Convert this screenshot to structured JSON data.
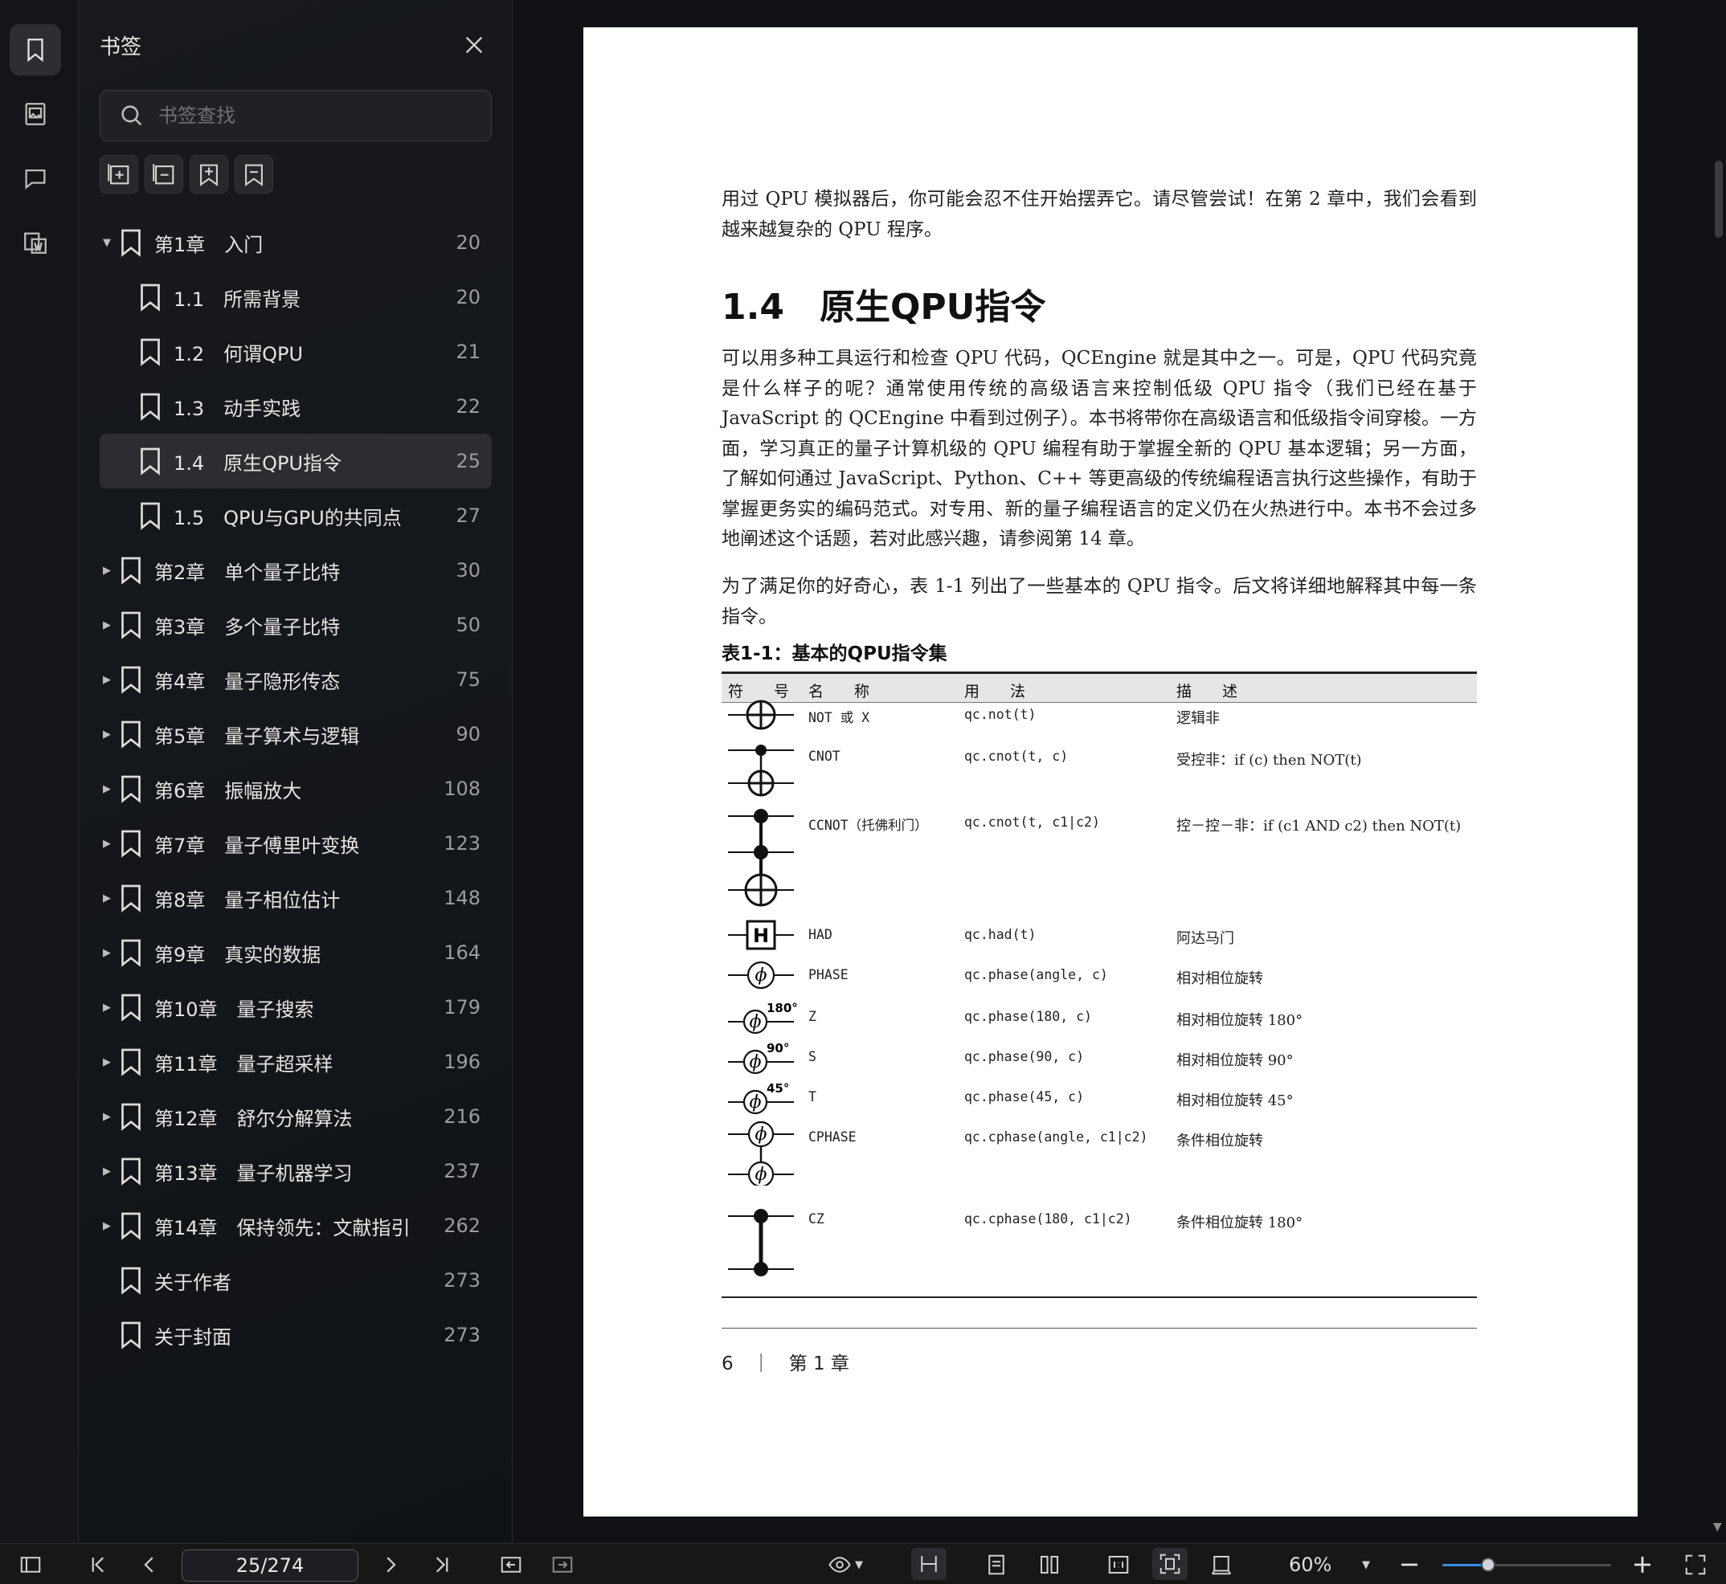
{
  "sidebar": {
    "title": "书签",
    "search_placeholder": "书签查找",
    "items": [
      {
        "label": "第1章　入门",
        "page": "20",
        "level": 0,
        "arrow": "▼"
      },
      {
        "label": "1.1　所需背景",
        "page": "20",
        "level": 1,
        "arrow": ""
      },
      {
        "label": "1.2　何谓QPU",
        "page": "21",
        "level": 1,
        "arrow": ""
      },
      {
        "label": "1.3　动手实践",
        "page": "22",
        "level": 1,
        "arrow": ""
      },
      {
        "label": "1.4　原生QPU指令",
        "page": "25",
        "level": 1,
        "arrow": "",
        "selected": true
      },
      {
        "label": "1.5　QPU与GPU的共同点",
        "page": "27",
        "level": 1,
        "arrow": ""
      },
      {
        "label": "第2章　单个量子比特",
        "page": "30",
        "level": 0,
        "arrow": "▶"
      },
      {
        "label": "第3章　多个量子比特",
        "page": "50",
        "level": 0,
        "arrow": "▶"
      },
      {
        "label": "第4章　量子隐形传态",
        "page": "75",
        "level": 0,
        "arrow": "▶"
      },
      {
        "label": "第5章　量子算术与逻辑",
        "page": "90",
        "level": 0,
        "arrow": "▶"
      },
      {
        "label": "第6章　振幅放大",
        "page": "108",
        "level": 0,
        "arrow": "▶"
      },
      {
        "label": "第7章　量子傅里叶变换",
        "page": "123",
        "level": 0,
        "arrow": "▶"
      },
      {
        "label": "第8章　量子相位估计",
        "page": "148",
        "level": 0,
        "arrow": "▶"
      },
      {
        "label": "第9章　真实的数据",
        "page": "164",
        "level": 0,
        "arrow": "▶"
      },
      {
        "label": "第10章　量子搜索",
        "page": "179",
        "level": 0,
        "arrow": "▶"
      },
      {
        "label": "第11章　量子超采样",
        "page": "196",
        "level": 0,
        "arrow": "▶"
      },
      {
        "label": "第12章　舒尔分解算法",
        "page": "216",
        "level": 0,
        "arrow": "▶"
      },
      {
        "label": "第13章　量子机器学习",
        "page": "237",
        "level": 0,
        "arrow": "▶"
      },
      {
        "label": "第14章　保持领先：文献指引",
        "page": "262",
        "level": 0,
        "arrow": "▶"
      },
      {
        "label": "关于作者",
        "page": "273",
        "level": 0,
        "arrow": ""
      },
      {
        "label": "关于封面",
        "page": "273",
        "level": 0,
        "arrow": ""
      }
    ]
  },
  "document": {
    "intro_paragraph": "用过 QPU 模拟器后，你可能会忍不住开始摆弄它。请尽管尝试！在第 2 章中，我们会看到越来越复杂的 QPU 程序。",
    "heading": "1.4　原生QPU指令",
    "paragraph_1": "可以用多种工具运行和检查 QPU 代码，QCEngine 就是其中之一。可是，QPU 代码究竟是什么样子的呢？通常使用传统的高级语言来控制低级 QPU 指令（我们已经在基于 JavaScript 的 QCEngine 中看到过例子）。本书将带你在高级语言和低级指令间穿梭。一方面，学习真正的量子计算机级的 QPU 编程有助于掌握全新的 QPU 基本逻辑；另一方面，了解如何通过 JavaScript、Python、C++ 等更高级的传统编程语言执行这些操作，有助于掌握更务实的编码范式。对专用、新的量子编程语言的定义仍在火热进行中。本书不会过多地阐述这个话题，若对此感兴趣，请参阅第 14 章。",
    "paragraph_2": "为了满足你的好奇心，表 1-1 列出了一些基本的 QPU 指令。后文将详细地解释其中每一条指令。",
    "table_caption": "表1-1：基本的QPU指令集",
    "table_headers": [
      "符　　号",
      "名　　称",
      "用　　法",
      "描　　述"
    ],
    "table_rows": [
      {
        "gate": "not",
        "name": "NOT 或 X",
        "usage": "qc.not(t)",
        "desc": "逻辑非"
      },
      {
        "gate": "cnot",
        "name": "CNOT",
        "usage": "qc.cnot(t, c)",
        "desc": "受控非：if (c) then NOT(t)"
      },
      {
        "gate": "ccnot",
        "name": "CCNOT（托佛利门）",
        "usage": "qc.cnot(t, c1|c2)",
        "desc": "控－控－非：if (c1 AND c2) then NOT(t)"
      },
      {
        "gate": "had",
        "name": "HAD",
        "usage": "qc.had(t)",
        "desc": "阿达马门"
      },
      {
        "gate": "phase",
        "name": "PHASE",
        "usage": "qc.phase(angle, c)",
        "desc": "相对相位旋转"
      },
      {
        "gate": "phase180",
        "name": "Z",
        "usage": "qc.phase(180, c)",
        "desc": "相对相位旋转 180°",
        "gate_label": "180°"
      },
      {
        "gate": "phase90",
        "name": "S",
        "usage": "qc.phase(90, c)",
        "desc": "相对相位旋转 90°",
        "gate_label": "90°"
      },
      {
        "gate": "phase45",
        "name": "T",
        "usage": "qc.phase(45, c)",
        "desc": "相对相位旋转 45°",
        "gate_label": "45°"
      },
      {
        "gate": "cphase",
        "name": "CPHASE",
        "usage": "qc.cphase(angle, c1|c2)",
        "desc": "条件相位旋转"
      },
      {
        "gate": "cz",
        "name": "CZ",
        "usage": "qc.cphase(180, c1|c2)",
        "desc": "条件相位旋转 180°"
      }
    ],
    "footer": "6　｜　第 1 章"
  },
  "toolbar": {
    "page_indicator": "25/274",
    "zoom": "60%",
    "zoom_slider_fraction": 0.27
  }
}
